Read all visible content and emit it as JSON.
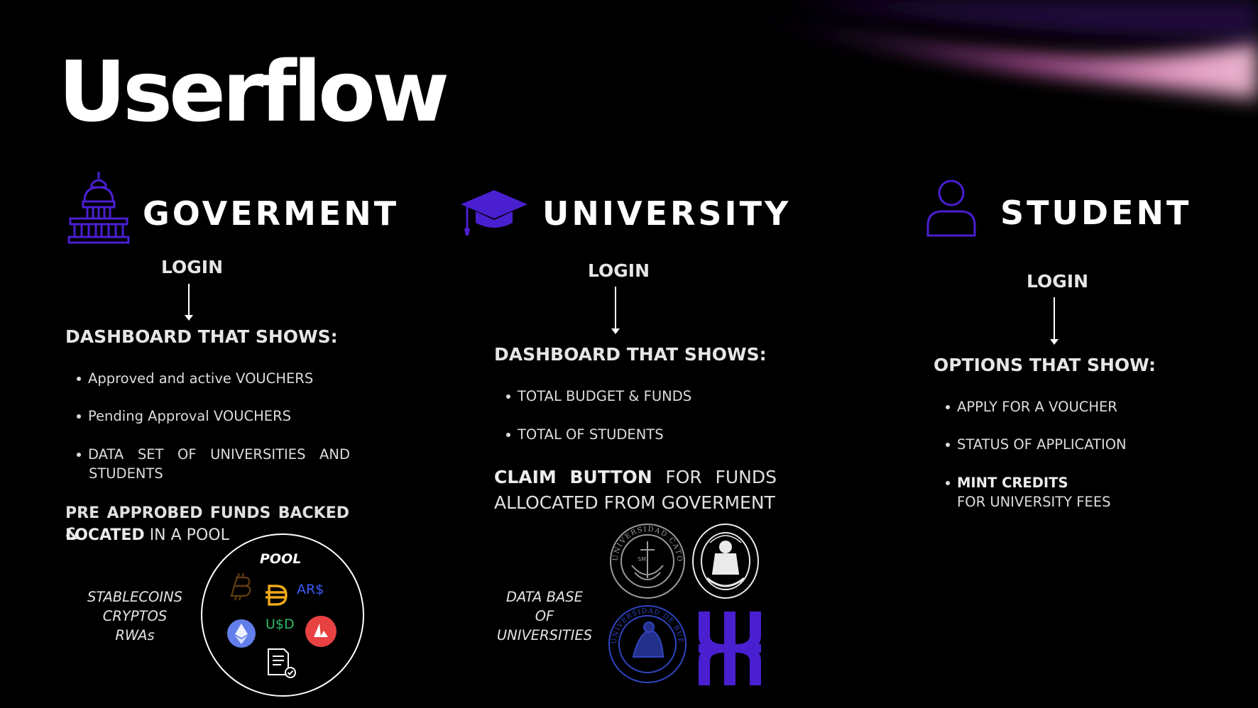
{
  "page": {
    "title": "Userflow"
  },
  "government": {
    "title": "GOVERMENT",
    "icon": "capitol-building-icon",
    "login": "LOGIN",
    "heading": "DASHBOARD THAT SHOWS:",
    "bullets": [
      "Approved and active VOUCHERS",
      "Pending Approval VOUCHERS",
      "DATA SET OF UNIVERSITIES AND",
      "STUDENTS"
    ],
    "funds_bold_1": "PRE APPROBED FUNDS BACKED &",
    "funds_bold_2": "LOCATED",
    "funds_rest": " IN A POOL",
    "asset_types": [
      "STABLECOINS",
      "CRYPTOS",
      "RWAs"
    ],
    "pool": {
      "label": "POOL",
      "tokens": {
        "ars": "AR$",
        "usd": "U$D"
      },
      "icons": [
        "bitcoin-icon",
        "dai-icon",
        "ethereum-icon",
        "avalanche-icon",
        "document-icon"
      ]
    }
  },
  "university": {
    "title": "UNIVERSITY",
    "icon": "graduation-cap-icon",
    "login": "LOGIN",
    "heading": "DASHBOARD THAT SHOWS:",
    "bullets": [
      "TOTAL BUDGET & FUNDS",
      "TOTAL OF STUDENTS"
    ],
    "claim_word_1": "CLAIM",
    "claim_word_2": "BUTTON",
    "claim_rest_1": "FOR",
    "claim_rest_2": "FUNDS",
    "claim_line_2": "ALLOCATED FROM GOVERMENT",
    "database_lines": [
      "DATA BASE",
      "OF",
      "UNIVERSITIES"
    ],
    "logos": [
      "uca-seal-icon",
      "unlp-seal-icon",
      "uba-seal-icon",
      "utn-logo-icon"
    ]
  },
  "student": {
    "title": "STUDENT",
    "icon": "person-outline-icon",
    "login": "LOGIN",
    "heading": "OPTIONS THAT SHOW:",
    "bullets": [
      "APPLY FOR A VOUCHER",
      "STATUS OF APPLICATION"
    ],
    "mint_bold": "MINT CREDITS",
    "mint_rest": "FOR UNIVERSITY FEES"
  },
  "colors": {
    "background": "#000000",
    "accent_purple": "#4a1fd0",
    "glow": "#e86ac8"
  }
}
